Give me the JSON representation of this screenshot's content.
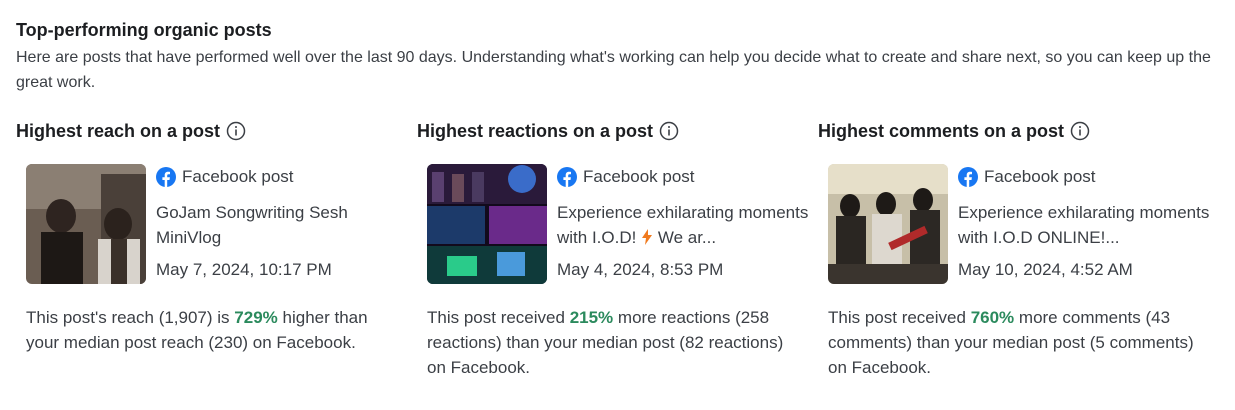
{
  "section": {
    "title": "Top-performing organic posts",
    "description": "Here are posts that have performed well over the last 90 days. Understanding what's working can help you decide what to create and share next, so you can keep up the great work."
  },
  "columns": [
    {
      "heading": "Highest reach on a post",
      "source": "Facebook post",
      "post_text": "GoJam Songwriting Sesh MiniVlog",
      "date": "May 7, 2024, 10:17 PM",
      "stat_prefix": "This post's reach (1,907) is",
      "stat_pct": "729%",
      "stat_suffix": "higher than your median post reach (230) on Facebook."
    },
    {
      "heading": "Highest reactions on a post",
      "source": "Facebook post",
      "post_text": "Experience exhilarating moments with I.O.D!",
      "post_text_tail": "We ar...",
      "date": "May 4, 2024, 8:53 PM",
      "stat_prefix": "This post received",
      "stat_pct": "215%",
      "stat_suffix": "more reactions (258 reactions) than your median post (82 reactions) on Facebook."
    },
    {
      "heading": "Highest comments on a post",
      "source": "Facebook post",
      "post_text": "Experience exhilarating moments with I.O.D ONLINE!...",
      "date": "May 10, 2024, 4:52 AM",
      "stat_prefix": "This post received",
      "stat_pct": "760%",
      "stat_suffix": "more comments (43 comments) than your median post (5 comments) on Facebook."
    }
  ],
  "colors": {
    "accent_green": "#2b8a5d",
    "facebook_blue": "#1877f2",
    "bolt_orange": "#f07a1e"
  },
  "icons": [
    "info-icon",
    "facebook-icon",
    "lightning-bolt-icon"
  ]
}
